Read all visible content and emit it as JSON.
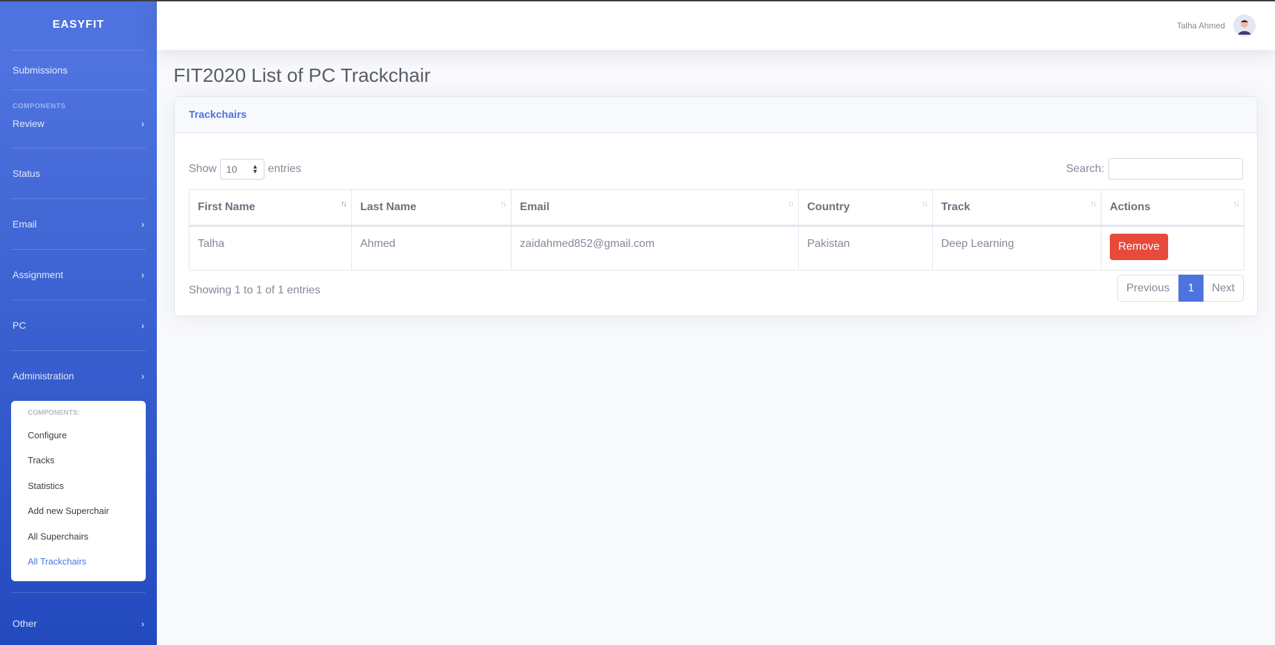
{
  "brand": "EASYFIT",
  "sidebar": {
    "submissions": "Submissions",
    "components_heading": "COMPONENTS",
    "items": [
      {
        "label": "Review"
      },
      {
        "label": "Status"
      },
      {
        "label": "Email"
      },
      {
        "label": "Assignment"
      },
      {
        "label": "PC"
      },
      {
        "label": "Administration"
      }
    ],
    "admin_submenu": {
      "heading": "COMPONENTS:",
      "items": [
        {
          "label": "Configure"
        },
        {
          "label": "Tracks"
        },
        {
          "label": "Statistics"
        },
        {
          "label": "Add new Superchair"
        },
        {
          "label": "All Superchairs"
        },
        {
          "label": "All Trackchairs"
        }
      ]
    },
    "other": "Other"
  },
  "topbar": {
    "user_name": "Talha Ahmed"
  },
  "page": {
    "title": "FIT2020 List of PC Trackchair"
  },
  "card": {
    "header": "Trackchairs",
    "show_label": "Show",
    "entries_label": "entries",
    "page_length": "10",
    "search_label": "Search:",
    "search_value": "",
    "columns": [
      "First Name",
      "Last Name",
      "Email",
      "Country",
      "Track",
      "Actions"
    ],
    "rows": [
      {
        "first": "Talha",
        "last": "Ahmed",
        "email": "zaidahmed852@gmail.com",
        "country": "Pakistan",
        "track": "Deep Learning",
        "action": "Remove"
      }
    ],
    "info": "Showing 1 to 1 of 1 entries",
    "pagination": {
      "prev": "Previous",
      "current": "1",
      "next": "Next"
    }
  },
  "colors": {
    "primary": "#4e73df",
    "danger": "#e74a3b"
  }
}
